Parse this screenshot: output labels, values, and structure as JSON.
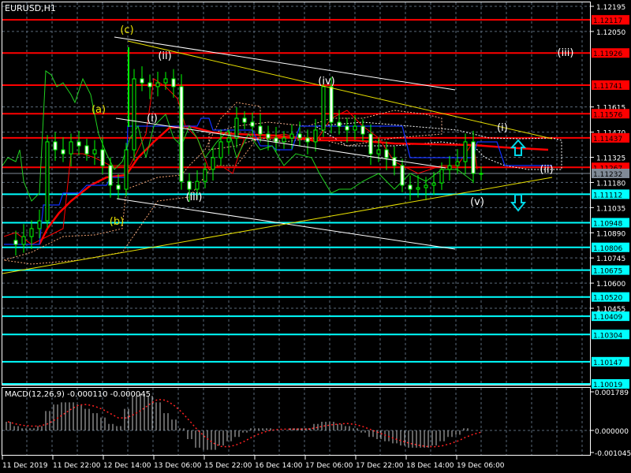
{
  "chart_data": {
    "type": "candlestick",
    "title": "EURUSD,H1",
    "symbol": "EURUSD",
    "timeframe": "H1",
    "ylim": [
      1.10019,
      1.12195
    ],
    "price_ticks": [
      "1.12195",
      "1.12050",
      "1.11615",
      "1.11470",
      "1.11325",
      "1.11180",
      "1.11035",
      "1.10890",
      "1.10745",
      "1.10600",
      "1.10455"
    ],
    "resistance_levels": [
      {
        "price": 1.12117,
        "label": "1.12117"
      },
      {
        "price": 1.11926,
        "label": "1.11926"
      },
      {
        "price": 1.11741,
        "label": "1.11741"
      },
      {
        "price": 1.11576,
        "label": "1.11576"
      },
      {
        "price": 1.11437,
        "label": "1.11437"
      },
      {
        "price": 1.11267,
        "label": "1.11267"
      }
    ],
    "support_levels": [
      {
        "price": 1.11112,
        "label": "1.11112"
      },
      {
        "price": 1.10948,
        "label": "1.10948"
      },
      {
        "price": 1.10806,
        "label": "1.10806"
      },
      {
        "price": 1.10675,
        "label": "1.10675"
      },
      {
        "price": 1.1052,
        "label": "1.10520"
      },
      {
        "price": 1.10409,
        "label": "1.10409"
      },
      {
        "price": 1.10304,
        "label": "1.10304"
      },
      {
        "price": 1.10147,
        "label": "1.10147"
      },
      {
        "price": 1.10019,
        "label": "1.10019"
      }
    ],
    "bid": {
      "price": 1.11232,
      "label": "1.11232"
    },
    "closes": [
      1.10846,
      1.10823,
      1.10868,
      1.10914,
      1.10959,
      1.11414,
      1.11368,
      1.11345,
      1.11414,
      1.11391,
      1.11345,
      1.11368,
      1.11277,
      1.11164,
      1.11141,
      1.11368,
      1.11777,
      1.11754,
      1.11732,
      1.11754,
      1.11777,
      1.11732,
      1.11186,
      1.11141,
      1.11186,
      1.11255,
      1.11323,
      1.11414,
      1.11436,
      1.1155,
      1.11527,
      1.11504,
      1.11459,
      1.11436,
      1.11414,
      1.11436,
      1.11459,
      1.11436,
      1.11414,
      1.11482,
      1.11732,
      1.11527,
      1.11504,
      1.11482,
      1.11504,
      1.11459,
      1.11345,
      1.11368,
      1.11323,
      1.11277,
      1.11164,
      1.11141,
      1.1115,
      1.11164,
      1.11177,
      1.11255,
      1.11277,
      1.113,
      1.11414,
      1.11232,
      1.11232
    ],
    "time_labels": [
      "11 Dec 2019",
      "11 Dec 22:00",
      "12 Dec 14:00",
      "13 Dec 06:00",
      "15 Dec 22:00",
      "16 Dec 14:00",
      "17 Dec 06:00",
      "17 Dec 22:00",
      "18 Dec 14:00",
      "19 Dec 06:00"
    ],
    "wave_labels": [
      {
        "text": "(c)",
        "color": "#e8e000"
      },
      {
        "text": "(a)",
        "color": "#e8e000"
      },
      {
        "text": "(b)",
        "color": "#e8e000"
      },
      {
        "text": "(ii)",
        "color": "#ffffff"
      },
      {
        "text": "(i)",
        "color": "#ffffff"
      },
      {
        "text": "(iii)",
        "color": "#ffffff"
      },
      {
        "text": "(iv)",
        "color": "#ffffff"
      },
      {
        "text": "(v)",
        "color": "#ffffff"
      },
      {
        "text": "(i)",
        "color": "#ffffff"
      },
      {
        "text": "(ii)",
        "color": "#ffffff"
      },
      {
        "text": "(iii)",
        "color": "#ffffff"
      }
    ],
    "macd": {
      "label": "MACD(12,26,9) -0.000110 -0.000045",
      "ylim": [
        -0.001045,
        0.001789
      ],
      "ticks": [
        "0.001789",
        "0.000000",
        "-0.001045"
      ],
      "histogram": [
        0.0004,
        0.0002,
        0.0001,
        0.0001,
        0.0002,
        0.0009,
        0.0012,
        0.0013,
        0.0013,
        0.0012,
        0.001,
        0.0008,
        0.0006,
        0.0003,
        0.0002,
        0.001,
        0.0016,
        0.0017,
        0.0016,
        0.0013,
        0.0008,
        0.0005,
        0.0001,
        -0.0004,
        -0.0008,
        -0.0009,
        -0.0009,
        -0.0007,
        -0.0005,
        -0.0003,
        -0.0001,
        0.0001,
        0.0001,
        0.0001,
        0.0,
        0.0,
        0.0001,
        0.0001,
        0.0001,
        0.0003,
        0.0004,
        0.0004,
        0.0003,
        0.0002,
        0.0001,
        -0.0001,
        -0.0003,
        -0.0004,
        -0.0005,
        -0.0006,
        -0.0007,
        -0.0008,
        -0.0008,
        -0.0008,
        -0.0007,
        -0.0005,
        -0.0003,
        -0.0002,
        0.0001,
        0.0,
        0.0
      ]
    },
    "colors": {
      "resistance": "#ff0000",
      "support": "#00ffff",
      "bull": "#00ff00",
      "grid": "#5a6a7a",
      "bid": "#808a96"
    }
  }
}
